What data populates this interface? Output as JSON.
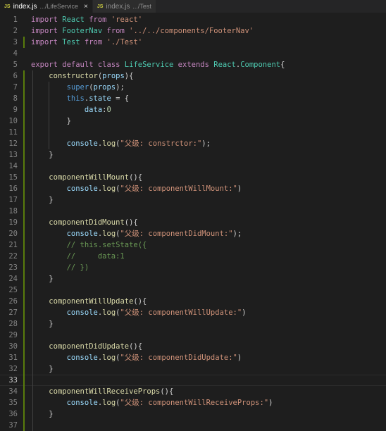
{
  "tabs": [
    {
      "filename": "index.js",
      "path": ".../LifeService",
      "active": true
    },
    {
      "filename": "index.js",
      "path": ".../Test",
      "active": false
    }
  ],
  "tab_icon": "JS",
  "close_icon": "×",
  "current_line": 33,
  "lines": [
    {
      "n": "1",
      "text": "import React from 'react'"
    },
    {
      "n": "2",
      "text": "import FooterNav from '../../components/FooterNav'"
    },
    {
      "n": "3",
      "text": "import Test from './Test'"
    },
    {
      "n": "4",
      "text": ""
    },
    {
      "n": "5",
      "text": "export default class LifeService extends React.Component{"
    },
    {
      "n": "6",
      "text": "    constructor(props){"
    },
    {
      "n": "7",
      "text": "        super(props);"
    },
    {
      "n": "8",
      "text": "        this.state = {"
    },
    {
      "n": "9",
      "text": "            data:0"
    },
    {
      "n": "10",
      "text": "        }"
    },
    {
      "n": "11",
      "text": ""
    },
    {
      "n": "12",
      "text": "        console.log(\"父级: constrctor:\");"
    },
    {
      "n": "13",
      "text": "    }"
    },
    {
      "n": "14",
      "text": ""
    },
    {
      "n": "15",
      "text": "    componentWillMount(){"
    },
    {
      "n": "16",
      "text": "        console.log(\"父级: componentWillMount:\")"
    },
    {
      "n": "17",
      "text": "    }"
    },
    {
      "n": "18",
      "text": ""
    },
    {
      "n": "19",
      "text": "    componentDidMount(){"
    },
    {
      "n": "20",
      "text": "        console.log(\"父级: componentDidMount:\");"
    },
    {
      "n": "21",
      "text": "        // this.setState({"
    },
    {
      "n": "22",
      "text": "        //     data:1"
    },
    {
      "n": "23",
      "text": "        // })"
    },
    {
      "n": "24",
      "text": "    }"
    },
    {
      "n": "25",
      "text": ""
    },
    {
      "n": "26",
      "text": "    componentWillUpdate(){"
    },
    {
      "n": "27",
      "text": "        console.log(\"父级: componentWillUpdate:\")"
    },
    {
      "n": "28",
      "text": "    }"
    },
    {
      "n": "29",
      "text": ""
    },
    {
      "n": "30",
      "text": "    componentDidUpdate(){"
    },
    {
      "n": "31",
      "text": "        console.log(\"父级: componentDidUpdate:\")"
    },
    {
      "n": "32",
      "text": "    }"
    },
    {
      "n": "33",
      "text": ""
    },
    {
      "n": "34",
      "text": "    componentWillReceiveProps(){"
    },
    {
      "n": "35",
      "text": "        console.log(\"父级: componentWillReceiveProps:\")"
    },
    {
      "n": "36",
      "text": "    }"
    },
    {
      "n": "37",
      "text": ""
    }
  ],
  "colors": {
    "background": "#1e1e1e",
    "keyword": "#569cd6",
    "control_keyword": "#c586c0",
    "string": "#ce9178",
    "class": "#4ec9b0",
    "function": "#dcdcaa",
    "variable": "#9cdcfe",
    "number": "#b5cea8",
    "comment": "#6a9955",
    "gutter_modified": "#587c0c"
  }
}
